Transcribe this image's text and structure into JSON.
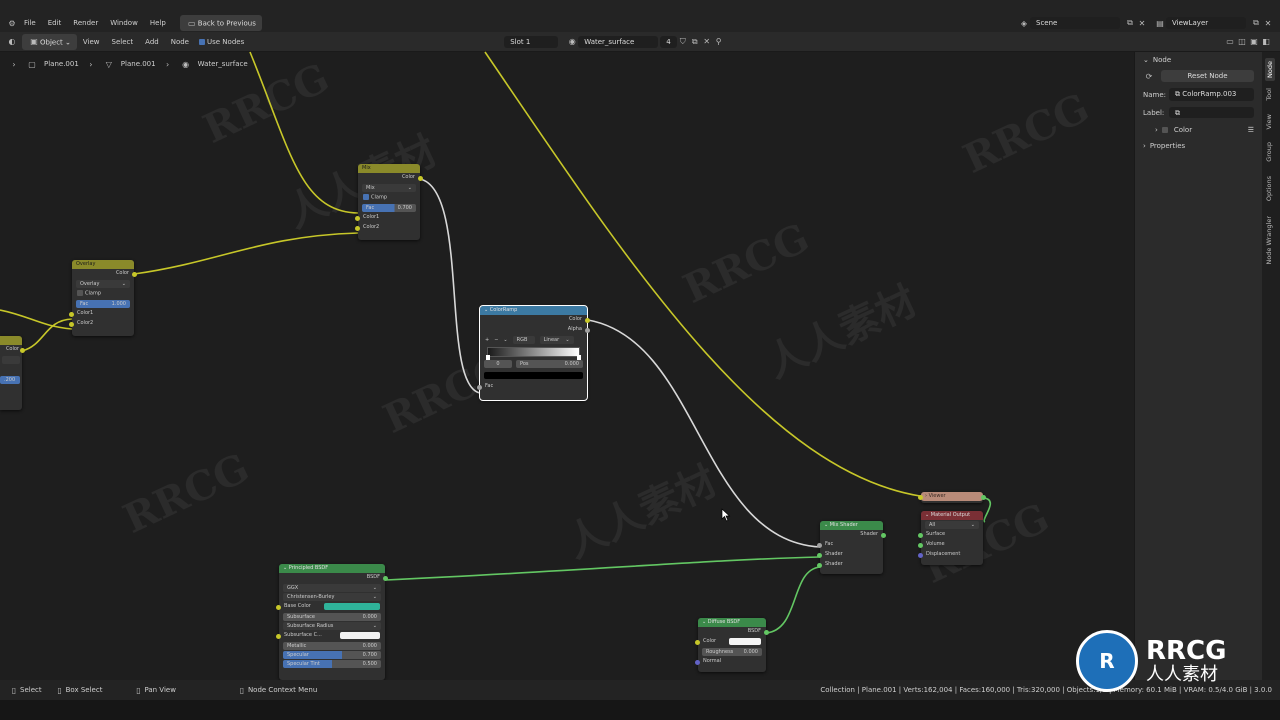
{
  "menubar": {
    "items": [
      "File",
      "Edit",
      "Render",
      "Window",
      "Help"
    ],
    "back_button": "Back to Previous",
    "scene": "Scene",
    "view_layer": "ViewLayer"
  },
  "header": {
    "mode": "Object",
    "menus": [
      "View",
      "Select",
      "Add",
      "Node"
    ],
    "use_nodes": "Use Nodes",
    "slot": "Slot 1",
    "material": "Water_surface",
    "users": "4"
  },
  "breadcrumb": [
    "Plane.001",
    "Plane.001",
    "Water_surface"
  ],
  "sidebar": {
    "panel_title": "Node",
    "reset_button": "Reset Node",
    "name_label": "Name:",
    "name_value": "ColorRamp.003",
    "label_label": "Label:",
    "color_section": "Color",
    "properties_section": "Properties",
    "tabs": [
      "Node",
      "Tool",
      "View",
      "Group",
      "Options",
      "Node Wrangler"
    ]
  },
  "nodes": {
    "mix": {
      "title": "Mix",
      "out": "Color",
      "blend": "Mix",
      "clamp": "Clamp",
      "fac_label": "Fac",
      "fac_value": "0.700",
      "in1": "Color1",
      "in2": "Color2"
    },
    "overlay": {
      "title": "Overlay",
      "out": "Color",
      "blend": "Overlay",
      "clamp": "Clamp",
      "fac_label": "Fac",
      "fac_value": "1.000",
      "in1": "Color1",
      "in2": "Color2"
    },
    "partial": {
      "out": "Color",
      "value": ".200"
    },
    "colorramp": {
      "title": "ColorRamp",
      "out1": "Color",
      "out2": "Alpha",
      "mode": "RGB",
      "interp": "Linear",
      "index": "0",
      "pos_label": "Pos",
      "pos_value": "0.000",
      "in": "Fac"
    },
    "viewer": {
      "title": "Viewer"
    },
    "output": {
      "title": "Material Output",
      "target": "All",
      "in1": "Surface",
      "in2": "Volume",
      "in3": "Displacement"
    },
    "mixshader": {
      "title": "Mix Shader",
      "out": "Shader",
      "in1": "Fac",
      "in2": "Shader",
      "in3": "Shader"
    },
    "principled": {
      "title": "Principled BSDF",
      "out": "BSDF",
      "dist": "GGX",
      "sss": "Christensen-Burley",
      "base_color": "Base Color",
      "subsurface": "Subsurface",
      "subsurface_value": "0.000",
      "subsurface_radius": "Subsurface Radius",
      "subsurface_color": "Subsurface C...",
      "metallic": "Metallic",
      "metallic_value": "0.000",
      "specular": "Specular",
      "specular_value": "0.700",
      "specular_tint": "Specular Tint",
      "specular_tint_value": "0.500"
    },
    "diffuse": {
      "title": "Diffuse BSDF",
      "out": "BSDF",
      "color": "Color",
      "roughness": "Roughness",
      "roughness_value": "0.000",
      "normal": "Normal"
    }
  },
  "statusbar": {
    "select": "Select",
    "box_select": "Box Select",
    "pan_view": "Pan View",
    "context_menu": "Node Context Menu",
    "stats": "Collection | Plane.001 | Verts:162,004 | Faces:160,000 | Tris:320,000 | Objects:1/1 | Memory: 60.1 MiB | VRAM: 0.5/4.0 GiB | 3.0.0"
  },
  "watermark": {
    "latin": "RRCG",
    "cjk": "人人素材"
  },
  "colors": {
    "accent": "#4772b3",
    "link_yellow": "#c7c729",
    "link_green": "#63c763",
    "selected_outline": "#ffffff"
  }
}
